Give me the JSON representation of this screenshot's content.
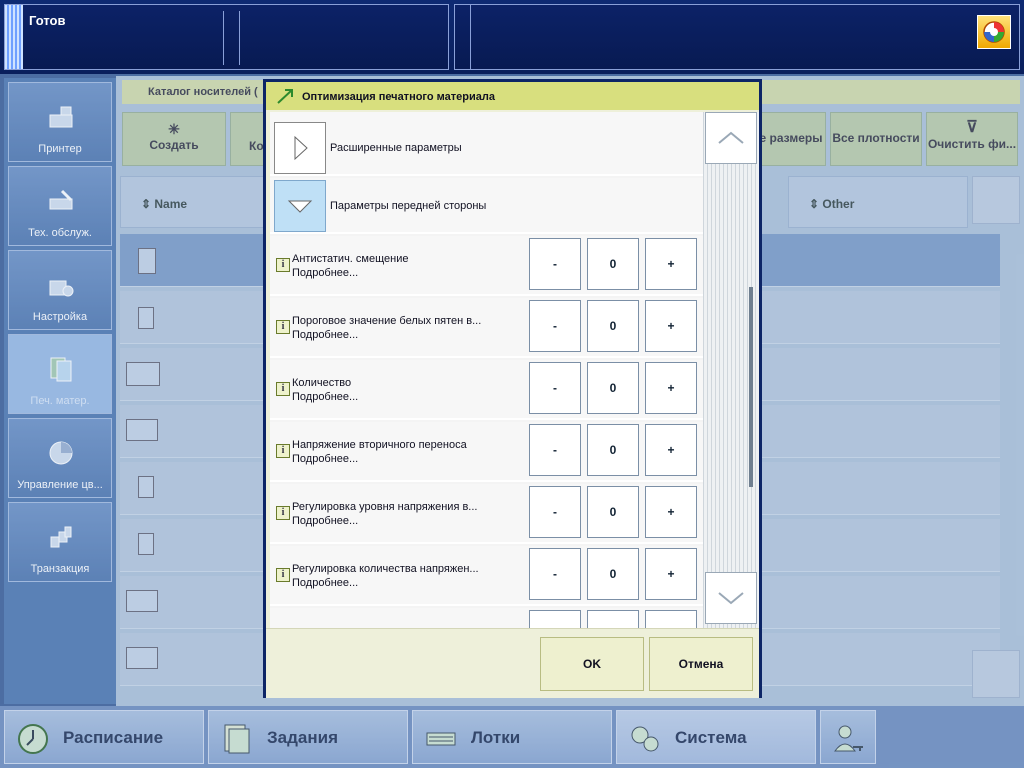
{
  "status": {
    "text": "Готов"
  },
  "sidebar": {
    "items": [
      {
        "label": "Принтер",
        "icon": "printer-icon"
      },
      {
        "label": "Тех. обслуж.",
        "icon": "maintenance-icon"
      },
      {
        "label": "Настройка",
        "icon": "settings-icon"
      },
      {
        "label": "Печ. матер.",
        "icon": "media-icon",
        "active": true
      },
      {
        "label": "Управление цв...",
        "icon": "color-icon"
      },
      {
        "label": "Транзакция",
        "icon": "transaction-icon"
      }
    ]
  },
  "content": {
    "title": "Каталог носителей (",
    "toolbar": {
      "create": "Создать",
      "partial": "Ко",
      "all_sizes": "е размеры",
      "all_weights": "Все плотности",
      "clear_filter": "Очистить фи..."
    },
    "columns": {
      "name": "Name",
      "other": "Other"
    }
  },
  "dialog": {
    "title": "Оптимизация печатного материала",
    "advanced": "Расширенные параметры",
    "front_side": "Параметры передней стороны",
    "more": "Подробнее...",
    "params": [
      {
        "name": "Антистатич. смещение",
        "value": "0"
      },
      {
        "name": "Пороговое значение белых пятен в...",
        "value": "0"
      },
      {
        "name": "Количество",
        "value": "0"
      },
      {
        "name": "Напряжение вторичного переноса",
        "value": "0"
      },
      {
        "name": "Регулировка уровня напряжения в...",
        "value": "0"
      },
      {
        "name": "Регулировка количества напряжен...",
        "value": "0"
      }
    ],
    "minus": "-",
    "plus": "+",
    "ok": "OK",
    "cancel": "Отмена"
  },
  "bottom_nav": {
    "schedule": "Расписание",
    "jobs": "Задания",
    "trays": "Лотки",
    "system": "Система"
  }
}
